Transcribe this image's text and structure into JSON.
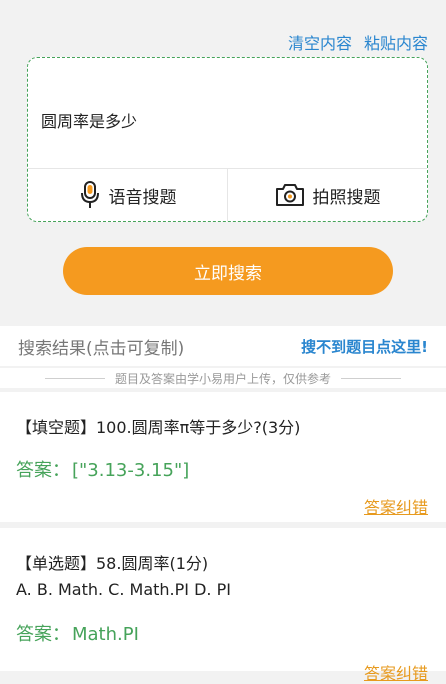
{
  "top_actions": {
    "clear": "清空内容",
    "paste": "粘贴内容"
  },
  "input": {
    "query": "圆周率是多少"
  },
  "actions": {
    "voice": "语音搜题",
    "photo": "拍照搜题"
  },
  "search_button": "立即搜索",
  "results": {
    "title": "搜索结果(点击可复制)",
    "not_found_link": "搜不到题目点这里!",
    "disclaimer": "题目及答案由学小易用户上传，仅供参考",
    "items": [
      {
        "question": "【填空题】100.圆周率π等于多少?(3分)",
        "options": "",
        "answer_label": "答案：",
        "answer": "[\"3.13-3.15\"]",
        "report": "答案纠错"
      },
      {
        "question": "【单选题】58.圆周率(1分)",
        "options": "A. B. Math. C. Math.PI D. PI",
        "answer_label": "答案：",
        "answer": "Math.PI",
        "report": "答案纠错"
      }
    ]
  },
  "colors": {
    "accent_blue": "#2a86cf",
    "orange": "#f59a1f",
    "green": "#46a35a"
  }
}
